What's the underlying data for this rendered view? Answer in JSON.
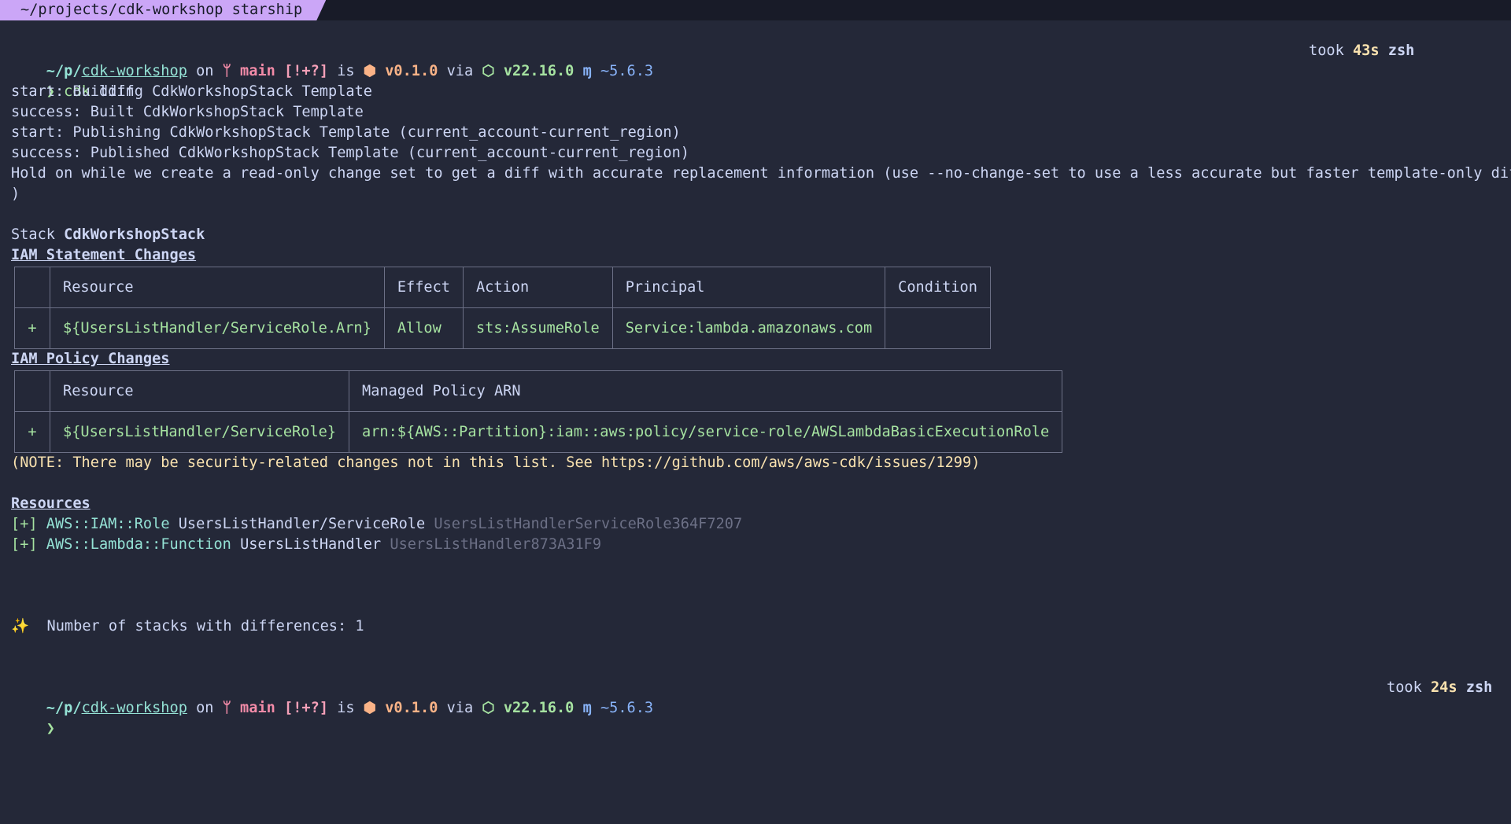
{
  "window": {
    "tab_title": "~/projects/cdk-workshop starship"
  },
  "prompt1": {
    "path_prefix": "~/p/",
    "dir": "cdk-workshop",
    "on": " on ",
    "branch_icon": "ᛘ",
    "branch": " main",
    "git_status": " [!+?]",
    "is": " is ",
    "pkg_icon": "⬢",
    "pkg_version": " v0.1.0",
    "via": " via ",
    "node_icon": "⬡",
    "node_version": " v22.16.0",
    "ts_icon": " ɱ",
    "ts_version": " ~5.6.3",
    "took": "took ",
    "duration": "43s",
    "shell": " zsh"
  },
  "command": {
    "arrow": "❯",
    "text": " cdk",
    "args": " diff"
  },
  "output_lines": [
    "start: Building CdkWorkshopStack Template",
    "success: Built CdkWorkshopStack Template",
    "start: Publishing CdkWorkshopStack Template (current_account-current_region)",
    "success: Published CdkWorkshopStack Template (current_account-current_region)",
    "Hold on while we create a read-only change set to get a diff with accurate replacement information (use --no-change-set to use a less accurate but faster template-only diff",
    ")"
  ],
  "stack": {
    "label": "Stack ",
    "name": "CdkWorkshopStack"
  },
  "iam_statement": {
    "heading": "IAM Statement Changes",
    "headers": [
      "",
      "Resource",
      "Effect",
      "Action",
      "Principal",
      "Condition"
    ],
    "rows": [
      [
        "+",
        "${UsersListHandler/ServiceRole.Arn}",
        "Allow",
        "sts:AssumeRole",
        "Service:lambda.amazonaws.com",
        ""
      ]
    ]
  },
  "iam_policy": {
    "heading": "IAM Policy Changes",
    "headers": [
      "",
      "Resource",
      "Managed Policy ARN"
    ],
    "rows": [
      [
        "+",
        "${UsersListHandler/ServiceRole}",
        "arn:${AWS::Partition}:iam::aws:policy/service-role/AWSLambdaBasicExecutionRole"
      ]
    ]
  },
  "note": "(NOTE: There may be security-related changes not in this list. See https://github.com/aws/aws-cdk/issues/1299)",
  "resources": {
    "heading": "Resources",
    "items": [
      {
        "marker": "[+]",
        "type": " AWS::IAM::Role",
        "name": " UsersListHandler/ServiceRole",
        "logical_id": " UsersListHandlerServiceRole364F7207"
      },
      {
        "marker": "[+]",
        "type": " AWS::Lambda::Function",
        "name": " UsersListHandler",
        "logical_id": " UsersListHandler873A31F9"
      }
    ]
  },
  "summary": {
    "icon": "✨",
    "text": "  Number of stacks with differences: 1"
  },
  "prompt2": {
    "path_prefix": "~/p/",
    "dir": "cdk-workshop",
    "on": " on ",
    "branch_icon": "ᛘ",
    "branch": " main",
    "git_status": " [!+?]",
    "is": " is ",
    "pkg_icon": "⬢",
    "pkg_version": " v0.1.0",
    "via": " via ",
    "node_icon": "⬡",
    "node_version": " v22.16.0",
    "ts_icon": " ɱ",
    "ts_version": " ~5.6.3",
    "took": "took ",
    "duration": "24s",
    "shell": " zsh"
  },
  "cursor_line": {
    "arrow": "❯"
  }
}
